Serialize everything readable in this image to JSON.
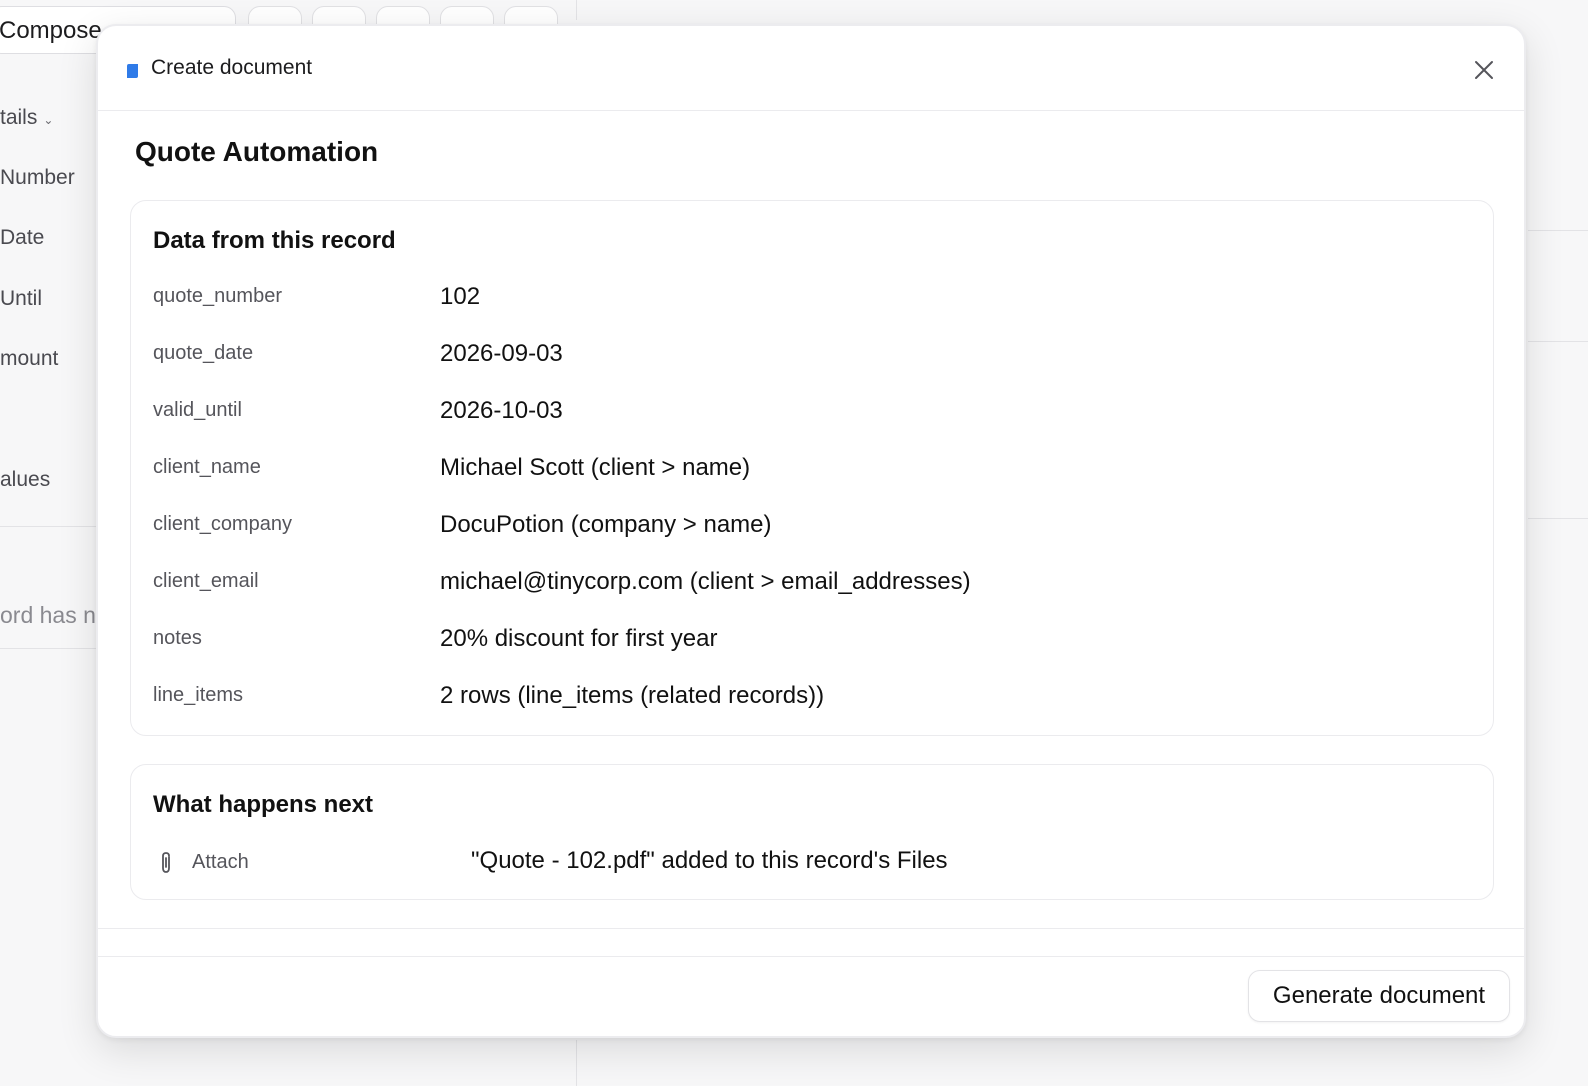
{
  "background": {
    "compose_label": "Compose",
    "details_label": "tails",
    "fields": [
      {
        "label": "Number"
      },
      {
        "label": "Date"
      },
      {
        "label": "Until"
      },
      {
        "label": "mount"
      },
      {
        "label": "alues"
      }
    ],
    "empty_text": "ord has n"
  },
  "modal": {
    "header_title": "Create document",
    "heading": "Quote Automation",
    "data_card": {
      "title": "Data from this record",
      "rows": [
        {
          "label": "quote_number",
          "value": "102"
        },
        {
          "label": "quote_date",
          "value": "2026-09-03"
        },
        {
          "label": "valid_until",
          "value": "2026-10-03"
        },
        {
          "label": "client_name",
          "value": "Michael Scott (client > name)"
        },
        {
          "label": "client_company",
          "value": "DocuPotion (company > name)"
        },
        {
          "label": "client_email",
          "value": "michael@tinycorp.com (client > email_addresses)"
        },
        {
          "label": "notes",
          "value": "20% discount for first year"
        },
        {
          "label": "line_items",
          "value": "2 rows (line_items (related records))"
        }
      ]
    },
    "next_card": {
      "title": "What happens next",
      "action_label": "Attach",
      "action_value": "\"Quote - 102.pdf\" added to this record's Files"
    },
    "generate_button": "Generate document"
  },
  "icons": {
    "doc": "document-icon",
    "close": "close-icon",
    "attach": "paperclip-icon",
    "chevron": "chevron-down-icon"
  },
  "colors": {
    "doc_icon": "#2f7be8",
    "text": "#111111",
    "muted": "#55555b"
  }
}
